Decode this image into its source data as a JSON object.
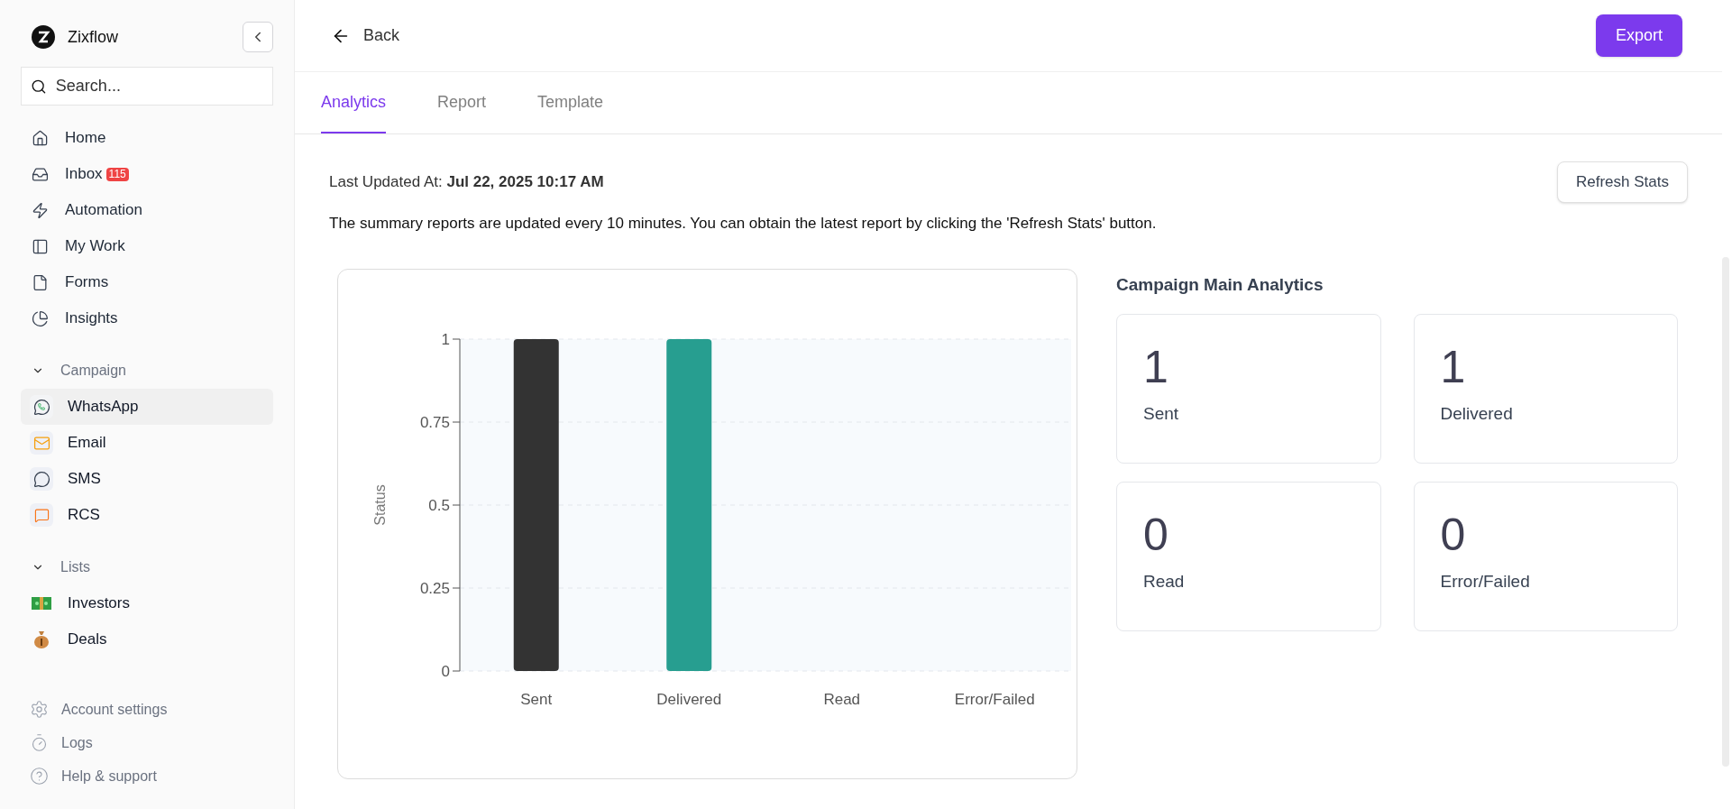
{
  "sidebar": {
    "brand": "Zixflow",
    "search": {
      "placeholder": "Search..."
    },
    "nav": [
      {
        "label": "Home",
        "selected": false
      },
      {
        "label": "Inbox",
        "badge": "115",
        "selected": false
      },
      {
        "label": "Automation",
        "selected": false
      },
      {
        "label": "My Work",
        "selected": false
      },
      {
        "label": "Forms",
        "selected": false
      },
      {
        "label": "Insights",
        "selected": false
      }
    ],
    "sections": [
      {
        "title": "Campaign",
        "expanded": true,
        "items": [
          {
            "label": "WhatsApp",
            "selected": true
          },
          {
            "label": "Email",
            "selected": false
          },
          {
            "label": "SMS",
            "selected": false
          },
          {
            "label": "RCS",
            "selected": false
          }
        ]
      },
      {
        "title": "Lists",
        "expanded": true,
        "items": [
          {
            "label": "Investors",
            "selected": false
          },
          {
            "label": "Deals",
            "selected": false
          }
        ]
      }
    ],
    "footer": [
      {
        "label": "Account settings"
      },
      {
        "label": "Logs"
      },
      {
        "label": "Help & support"
      }
    ]
  },
  "header": {
    "back": "Back",
    "export": "Export"
  },
  "tabs": [
    {
      "label": "Analytics",
      "selected": true
    },
    {
      "label": "Report",
      "selected": false
    },
    {
      "label": "Template",
      "selected": false
    }
  ],
  "last_updated": "Last Updated At: **Jul 22, 2025 10:17 AM**",
  "refresh_button": "Refresh Stats",
  "note": "The summary reports are updated every 10 minutes. You can obtain the latest report by clicking the 'Refresh Stats' button.",
  "chart": {
    "chart_data": {
      "type": "bar",
      "ylabel": "Status",
      "categories": [
        "Sent",
        "Delivered",
        "Read",
        "Error/Failed"
      ],
      "series": [
        {
          "color": "#333333",
          "values": [
            1,
            null,
            null,
            null
          ]
        },
        {
          "color": "#279e90",
          "values": [
            null,
            1,
            null,
            null
          ]
        },
        {
          "values": [
            null,
            null,
            0,
            0
          ]
        }
      ],
      "grid": true,
      "ylim": [
        0,
        1
      ],
      "yticks": [
        0,
        0.25,
        0.5,
        0.75,
        1
      ]
    }
  },
  "analytics": {
    "title": "Campaign Main Analytics",
    "cards": [
      {
        "value": "1",
        "label": "Sent"
      },
      {
        "value": "1",
        "label": "Delivered"
      },
      {
        "value": "0",
        "label": "Read"
      },
      {
        "value": "0",
        "label": "Error/Failed"
      }
    ]
  }
}
